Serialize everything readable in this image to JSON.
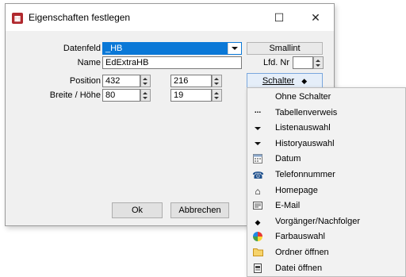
{
  "dialog": {
    "title": "Eigenschaften festlegen",
    "close_glyph": "✕",
    "minimize_glyph": "☐"
  },
  "form": {
    "datenfeld_label": "Datenfeld",
    "datenfeld_value": "_HB",
    "datatype_value": "Smallint",
    "name_label": "Name",
    "name_value": "EdExtraHB",
    "lfd_label": "Lfd. Nr",
    "lfd_value": "",
    "position_label": "Position",
    "position_x": "432",
    "position_y": "216",
    "size_label": "Breite / Höhe",
    "width_value": "80",
    "height_value": "19",
    "schalter_button": "Schalter"
  },
  "buttons": {
    "ok": "Ok",
    "cancel": "Abbrechen"
  },
  "menu": {
    "items": [
      {
        "label": "Ohne Schalter",
        "icon": ""
      },
      {
        "label": "Tabellenverweis",
        "icon": "ellipsis-icon"
      },
      {
        "label": "Listenauswahl",
        "icon": "triangle-down-icon"
      },
      {
        "label": "Historyauswahl",
        "icon": "triangle-down-icon"
      },
      {
        "label": "Datum",
        "icon": "calendar-icon"
      },
      {
        "label": "Telefonnummer",
        "icon": "phone-icon"
      },
      {
        "label": "Homepage",
        "icon": "house-icon"
      },
      {
        "label": "E-Mail",
        "icon": "mail-icon"
      },
      {
        "label": "Vorgänger/Nachfolger",
        "icon": "updown-icon"
      },
      {
        "label": "Farbauswahl",
        "icon": "color-wheel-icon"
      },
      {
        "label": "Ordner öffnen",
        "icon": "folder-icon"
      },
      {
        "label": "Datei öffnen",
        "icon": "file-icon"
      }
    ]
  },
  "colors": {
    "selection": "#0a78d7",
    "app_icon": "#b0282d",
    "folder": "#e8b838"
  }
}
